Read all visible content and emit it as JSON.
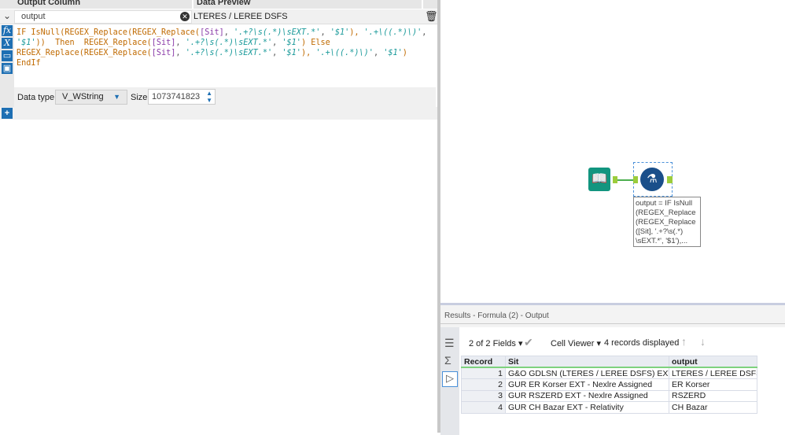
{
  "formula_panel": {
    "col_output": "Output Column",
    "col_preview": "Data Preview",
    "output_name": "output",
    "preview_value": "LTERES / LEREE DSFS",
    "formula_lines": [
      [
        [
          "kw",
          "IF IsNull(REGEX_Replace(REGEX_Replace("
        ],
        [
          "fld",
          "[Sit]"
        ],
        [
          "op",
          ", "
        ],
        [
          "str",
          "'.+?\\s(.*)\\sEXT.*'"
        ],
        [
          "op",
          ", "
        ],
        [
          "str",
          "'$1'"
        ],
        [
          "kw",
          "), "
        ],
        [
          "str",
          "'.+\\((.*)\\)'"
        ],
        [
          "op",
          ","
        ]
      ],
      [
        [
          "str",
          "'$1'"
        ],
        [
          "kw",
          "))  Then  REGEX_Replace("
        ],
        [
          "fld",
          "[Sit]"
        ],
        [
          "op",
          ", "
        ],
        [
          "str",
          "'.+?\\s(.*)\\sEXT.*'"
        ],
        [
          "op",
          ", "
        ],
        [
          "str",
          "'$1'"
        ],
        [
          "kw",
          ") Else"
        ]
      ],
      [
        [
          "kw",
          "REGEX_Replace(REGEX_Replace("
        ],
        [
          "fld",
          "[Sit]"
        ],
        [
          "op",
          ", "
        ],
        [
          "str",
          "'.+?\\s(.*)\\sEXT.*'"
        ],
        [
          "op",
          ", "
        ],
        [
          "str",
          "'$1'"
        ],
        [
          "kw",
          "), "
        ],
        [
          "str",
          "'.+\\((.*)\\)'"
        ],
        [
          "op",
          ", "
        ],
        [
          "str",
          "'$1'"
        ],
        [
          "kw",
          ")"
        ]
      ],
      [
        [
          "kw",
          "EndIf"
        ]
      ]
    ],
    "data_type_label": "Data type:",
    "data_type_value": "V_WString",
    "size_label": "Size:",
    "size_value": "1073741823"
  },
  "canvas": {
    "annotation": "output = IF IsNull (REGEX_Replace (REGEX_Replace ([Sit], '.+?\\s(.*) \\sEXT.*', '$1'),..."
  },
  "results": {
    "title": "Results - Formula (2) - Output",
    "fields": "2 of 2 Fields",
    "viewer": "Cell Viewer",
    "records": "4 records displayed",
    "columns": [
      "Record",
      "Sit",
      "output"
    ],
    "rows": [
      [
        "1",
        "G&O GDLSN (LTERES / LEREE DSFS) EXT - Nexlre...",
        "LTERES / LEREE DSFS"
      ],
      [
        "2",
        "GUR ER Korser EXT - Nexlre Assigned",
        "ER Korser"
      ],
      [
        "3",
        "GUR RSZERD EXT - Nexlre Assigned",
        "RSZERD"
      ],
      [
        "4",
        "GUR CH Bazar EXT - Relativity",
        "CH Bazar"
      ]
    ]
  },
  "colors": {
    "accent": "#1e6fb3",
    "tool_teal": "#12957f",
    "formula_tool": "#1a4f8a",
    "connector": "#9ccc3c"
  }
}
